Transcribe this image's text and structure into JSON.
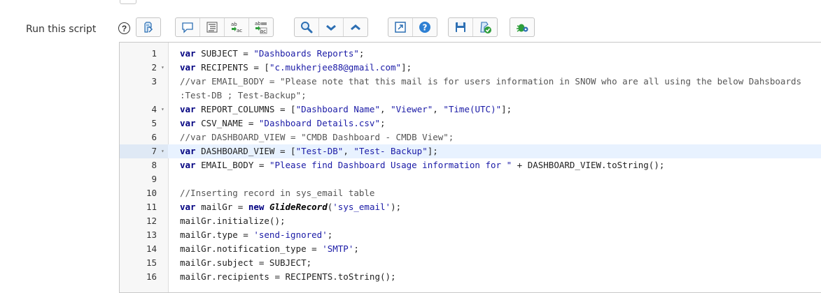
{
  "field": {
    "label": "Run this script",
    "help_glyph": "?"
  },
  "toolbar": {
    "icons": [
      "script-toggle-icon",
      "comment-icon",
      "format-icon",
      "replace-icon",
      "replace-all-icon",
      "search-icon",
      "chevron-down-icon",
      "chevron-up-icon",
      "fullscreen-icon",
      "help-icon",
      "save-icon",
      "check-syntax-icon",
      "debug-icon"
    ]
  },
  "editor": {
    "lines": [
      {
        "n": "1",
        "fold": "",
        "tokens": [
          [
            "k",
            "var"
          ],
          [
            "p",
            " SUBJECT = "
          ],
          [
            "s",
            "\"Dashboards Reports\""
          ],
          [
            "p",
            ";"
          ]
        ]
      },
      {
        "n": "2",
        "fold": "▾",
        "tokens": [
          [
            "k",
            "var"
          ],
          [
            "p",
            " RECIPENTS = ["
          ],
          [
            "s",
            "\"c.mukherjee88@gmail.com\""
          ],
          [
            "p",
            "];"
          ]
        ]
      },
      {
        "n": "3",
        "fold": "",
        "wrap": true,
        "tokens": [
          [
            "c",
            "//var EMAIL_BODY = \"Please note that this mail is for users information in SNOW who are all using the below Dahsboards :Test-DB ; Test-Backup\";"
          ]
        ]
      },
      {
        "n": "4",
        "fold": "▾",
        "tokens": [
          [
            "k",
            "var"
          ],
          [
            "p",
            " REPORT_COLUMNS = ["
          ],
          [
            "s",
            "\"Dashboard Name\""
          ],
          [
            "p",
            ", "
          ],
          [
            "s",
            "\"Viewer\""
          ],
          [
            "p",
            ", "
          ],
          [
            "s",
            "\"Time(UTC)\""
          ],
          [
            "p",
            "];"
          ]
        ]
      },
      {
        "n": "5",
        "fold": "",
        "tokens": [
          [
            "k",
            "var"
          ],
          [
            "p",
            " CSV_NAME = "
          ],
          [
            "s",
            "\"Dashboard Details.csv\""
          ],
          [
            "p",
            ";"
          ]
        ]
      },
      {
        "n": "6",
        "fold": "",
        "tokens": [
          [
            "c",
            "//var DASHBOARD_VIEW = \"CMDB Dashboard - CMDB View\";"
          ]
        ]
      },
      {
        "n": "7",
        "fold": "▾",
        "active": true,
        "tokens": [
          [
            "k",
            "var"
          ],
          [
            "p",
            " DASHBOARD_VIEW = ["
          ],
          [
            "s",
            "\"Test-DB\""
          ],
          [
            "p",
            ", "
          ],
          [
            "s",
            "\"Test- Backup\""
          ],
          [
            "p",
            "];"
          ]
        ]
      },
      {
        "n": "8",
        "fold": "",
        "tokens": [
          [
            "k",
            "var"
          ],
          [
            "p",
            " EMAIL_BODY = "
          ],
          [
            "s",
            "\"Please find Dashboard Usage information for \""
          ],
          [
            "p",
            " + DASHBOARD_VIEW.toString();"
          ]
        ]
      },
      {
        "n": "9",
        "fold": "",
        "tokens": []
      },
      {
        "n": "10",
        "fold": "",
        "tokens": [
          [
            "c",
            "//Inserting record in sys_email table"
          ]
        ]
      },
      {
        "n": "11",
        "fold": "",
        "tokens": [
          [
            "k",
            "var"
          ],
          [
            "p",
            " mailGr = "
          ],
          [
            "k",
            "new"
          ],
          [
            "p",
            " "
          ],
          [
            "f",
            "GlideRecord"
          ],
          [
            "p",
            "("
          ],
          [
            "s",
            "'sys_email'"
          ],
          [
            "p",
            ");"
          ]
        ]
      },
      {
        "n": "12",
        "fold": "",
        "tokens": [
          [
            "p",
            "mailGr.initialize();"
          ]
        ]
      },
      {
        "n": "13",
        "fold": "",
        "tokens": [
          [
            "p",
            "mailGr.type = "
          ],
          [
            "s",
            "'send-ignored'"
          ],
          [
            "p",
            ";"
          ]
        ]
      },
      {
        "n": "14",
        "fold": "",
        "tokens": [
          [
            "p",
            "mailGr.notification_type = "
          ],
          [
            "s",
            "'SMTP'"
          ],
          [
            "p",
            ";"
          ]
        ]
      },
      {
        "n": "15",
        "fold": "",
        "tokens": [
          [
            "p",
            "mailGr.subject = SUBJECT;"
          ]
        ]
      },
      {
        "n": "16",
        "fold": "",
        "tokens": [
          [
            "p",
            "mailGr.recipients = RECIPENTS.toString();"
          ]
        ]
      }
    ]
  }
}
